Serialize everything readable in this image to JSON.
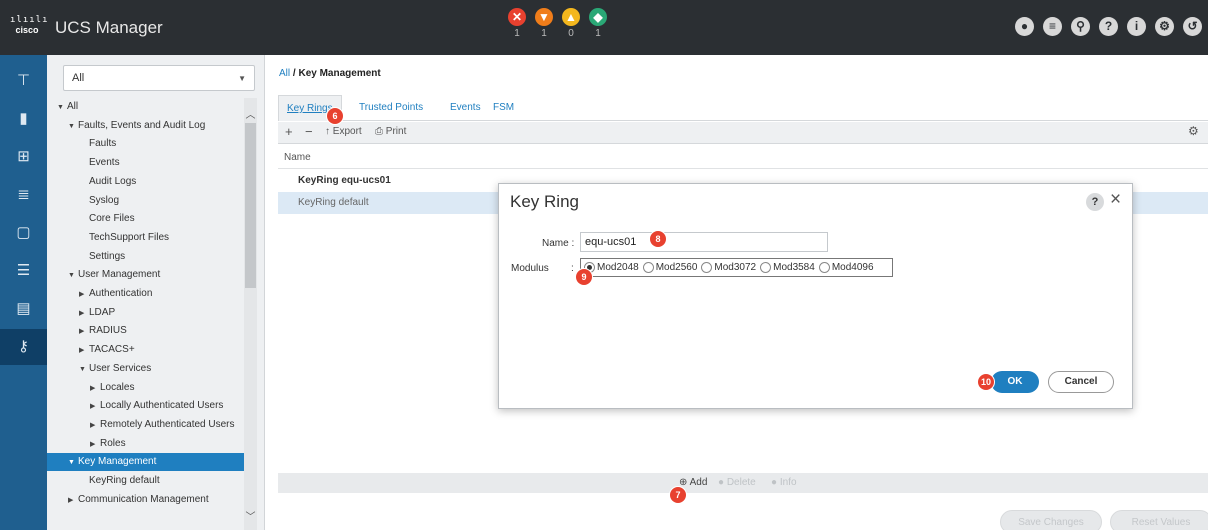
{
  "header": {
    "logo_text": "cisco",
    "app_title": "UCS Manager",
    "faults": [
      {
        "name": "critical",
        "glyph": "✕",
        "count": "1",
        "color": "#e8412f"
      },
      {
        "name": "major",
        "glyph": "▼",
        "count": "1",
        "color": "#f07d1a"
      },
      {
        "name": "minor",
        "glyph": "▲",
        "count": "0",
        "color": "#f3b71e"
      },
      {
        "name": "warning",
        "glyph": "◆",
        "count": "1",
        "color": "#2aa876"
      }
    ],
    "icons": [
      "globe-icon",
      "list-icon",
      "search-icon",
      "help-icon",
      "info-icon",
      "settings-icon",
      "logout-icon"
    ]
  },
  "nav_strip": {
    "items": [
      "equipment-icon",
      "servers-icon",
      "lan-icon",
      "san-icon",
      "vm-icon",
      "storage-icon",
      "chassis-icon",
      "admin-icon"
    ],
    "active_index": 7
  },
  "tree": {
    "filter_value": "All",
    "items": [
      {
        "label": "All",
        "arrow": "▼",
        "indent": 0
      },
      {
        "label": "Faults, Events and Audit Log",
        "arrow": "▼",
        "indent": 1
      },
      {
        "label": "Faults",
        "arrow": "",
        "indent": 2
      },
      {
        "label": "Events",
        "arrow": "",
        "indent": 2
      },
      {
        "label": "Audit Logs",
        "arrow": "",
        "indent": 2
      },
      {
        "label": "Syslog",
        "arrow": "",
        "indent": 2
      },
      {
        "label": "Core Files",
        "arrow": "",
        "indent": 2
      },
      {
        "label": "TechSupport Files",
        "arrow": "",
        "indent": 2
      },
      {
        "label": "Settings",
        "arrow": "",
        "indent": 2
      },
      {
        "label": "User Management",
        "arrow": "▼",
        "indent": 1
      },
      {
        "label": "Authentication",
        "arrow": "▶",
        "indent": 2
      },
      {
        "label": "LDAP",
        "arrow": "▶",
        "indent": 2
      },
      {
        "label": "RADIUS",
        "arrow": "▶",
        "indent": 2
      },
      {
        "label": "TACACS+",
        "arrow": "▶",
        "indent": 2
      },
      {
        "label": "User Services",
        "arrow": "▼",
        "indent": 2
      },
      {
        "label": "Locales",
        "arrow": "▶",
        "indent": 3
      },
      {
        "label": "Locally Authenticated Users",
        "arrow": "▶",
        "indent": 3
      },
      {
        "label": "Remotely Authenticated Users",
        "arrow": "▶",
        "indent": 3
      },
      {
        "label": "Roles",
        "arrow": "▶",
        "indent": 3
      },
      {
        "label": "Key Management",
        "arrow": "▼",
        "indent": 1,
        "selected": true
      },
      {
        "label": "KeyRing default",
        "arrow": "",
        "indent": 2
      },
      {
        "label": "Communication Management",
        "arrow": "▶",
        "indent": 1
      }
    ]
  },
  "main": {
    "breadcrumb_root": "All",
    "breadcrumb_sep": "/",
    "breadcrumb_current": "Key Management",
    "tabs": [
      "Key Rings",
      "Trusted Points",
      "Events",
      "FSM"
    ],
    "toolbar": {
      "add": "+",
      "remove": "−",
      "export": "Export",
      "print": "Print"
    },
    "grid_header": "Name",
    "rows": [
      "KeyRing equ-ucs01",
      "KeyRing default"
    ],
    "bottom_actions": {
      "add": "Add",
      "delete": "Delete",
      "info": "Info"
    },
    "footer_buttons": [
      "Save Changes",
      "Reset Values"
    ]
  },
  "dialog": {
    "title": "Key Ring",
    "help": "?",
    "close": "×",
    "name_label": "Name :",
    "name_value": "equ-ucs01",
    "modulus_label": "Modulus",
    "modulus_colon": ":",
    "modulus_options": [
      "Mod2048",
      "Mod2560",
      "Mod3072",
      "Mod3584",
      "Mod4096"
    ],
    "modulus_selected": "Mod2048",
    "ok_label": "OK",
    "cancel_label": "Cancel"
  },
  "markers": [
    "6",
    "7",
    "8",
    "9",
    "10"
  ]
}
